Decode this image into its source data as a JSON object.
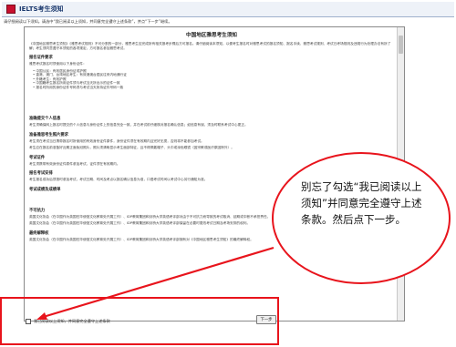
{
  "header": {
    "title": "IELTS考生须知",
    "intro": "请仔细阅读以下须知。请选中“我已阅读以上须知，并同意完全遵守上述条款”，并点“下一步”继续。"
  },
  "notice": {
    "title": "中国地区雅思考生须知",
    "intro_paragraph": "《中国地区雅思考生须知》《雅思考试规则》不可分割的一部分，雅思考生应完成所有相关报考步骤后方可报名。请仔细阅读本须知，以便考生报名时对雅思考试的报名须知、报名手续、雅思考试规则、考试日考场规则及违规行为处理办法有所了解；考生须同意遵守本须知的各项规定，方可报名参加雅思考试。",
    "sections": [
      {
        "heading": "报名证件要求",
        "lines": [
          "雅思考试报名时须使用以下身份证件：",
          "中国公民：有效居民身份证或护照",
          "香港、澳门、台湾地区考生：有效港澳台居民往来内地通行证",
          "外籍考生：有效护照",
          "中国籍考生报名所用证件须与考试当天所出示的证件一致",
          "报名时所用的身份证件号码须与考试当天所持证件号码一致"
        ]
      },
      {
        "heading": "准确提交个人信息",
        "lines": [
          "考生须确保网上报名时提交的个人信息与身份证件上的信息完全一致，并在考试前仔细核对报名确认信息；如信息有误，须及时联系考试中心更正。"
        ]
      },
      {
        "heading": "准备雅思考生照片要求",
        "lines": [
          "考生须在考试当日携带报名时所使用的有效身份证件原件，身份证件须在有效期内且完好无损，否则将不能参加考试。",
          "考生应在报名前准备好近期正面免冠照片，照片须清晰显示考生面部特征，且不得佩戴帽子、头巾或深色眼镜（因宗教或医疗原因除外）。"
        ]
      },
      {
        "heading": "考试证件",
        "lines": [
          "考生须携带有效身份证件原件参加考试，证件须在有效期内。"
        ]
      },
      {
        "heading": "报名考试安排",
        "lines": [
          "考生报名成功后须按时参加考试，考试日期、时间及考点以报名确认信息为准，口语考试时间以考试中心另行通知为准。"
        ]
      },
      {
        "heading": "考试成绩及成绩单",
        "lines": []
      },
      {
        "heading": "不可抗力",
        "lines": [
          "英国文化协会（在中国作为英国驻华使馆文化教育处开展工作）、IDP教育集团和剑桥大学英语考评部对由于不可抗力而导致的考试取消、延期或中断不承担责任。",
          "英国文化协会（在中国作为英国驻华使馆文化教育处开展工作）、IDP教育集团和剑桥大学英语考评部保留在必要时更改考试日期及考场安排的权利。"
        ]
      },
      {
        "heading": "最终解释权",
        "lines": [
          "英国文化协会（在中国作为英国驻华使馆文化教育处开展工作）、IDP教育集团和剑桥大学英语考评部拥有对《中国地区雅思考生须知》的最终解释权。"
        ]
      }
    ]
  },
  "agreement": {
    "checkbox_label": "我已阅读以上须知，并同意完全遵守上述条款",
    "checked": false,
    "next_button": "下一步"
  },
  "annotation": {
    "text": "别忘了勾选“我已阅读以上须知”并同意完全遵守上述条款。然后点下一步。",
    "color": "#e8141c"
  }
}
